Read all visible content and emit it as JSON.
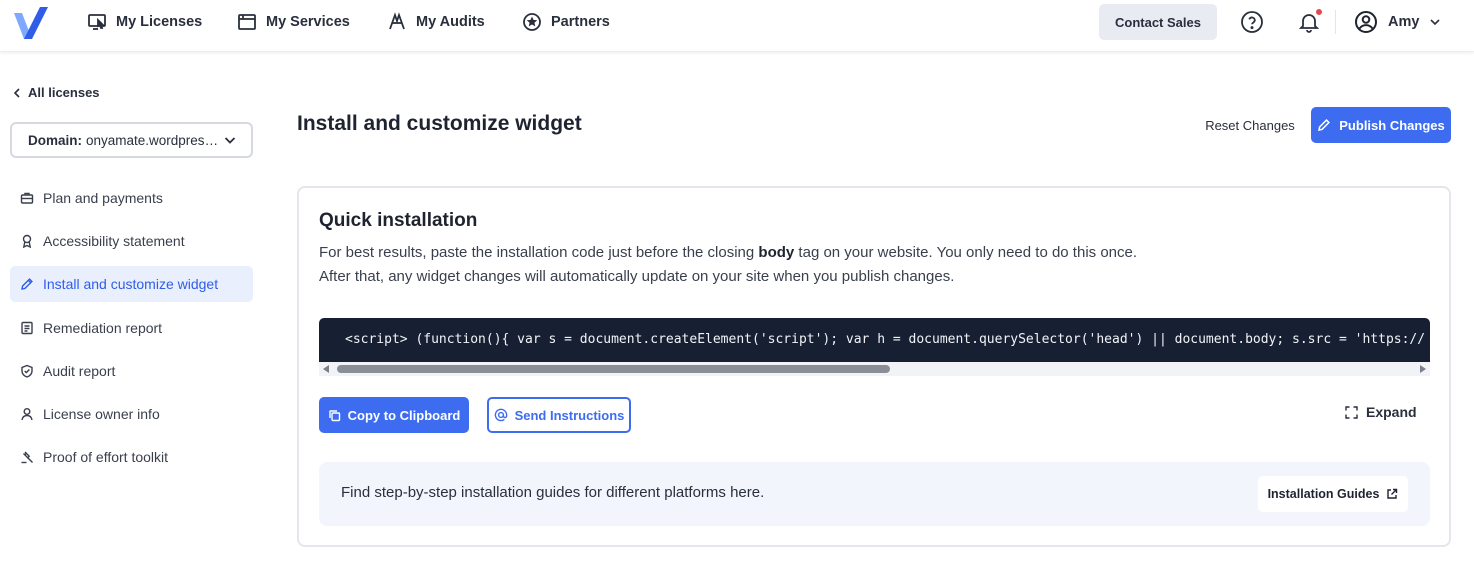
{
  "header": {
    "logo_icon": "checkmark-logo-icon",
    "nav": [
      {
        "label": "My Licenses",
        "icon": "monitor-cursor-icon"
      },
      {
        "label": "My Services",
        "icon": "window-icon"
      },
      {
        "label": "My Audits",
        "icon": "audit-compass-icon"
      },
      {
        "label": "Partners",
        "icon": "star-circle-icon"
      }
    ],
    "contact_sales": "Contact Sales",
    "help_icon": "question-circle-icon",
    "notification_icon": "bell-icon",
    "user": {
      "name": "Amy",
      "icon": "user-circle-icon"
    }
  },
  "sidebar": {
    "back_label": "All licenses",
    "domain": {
      "label": "Domain:",
      "value": "onyamate.wordpress.com"
    },
    "items": [
      {
        "label": "Plan and payments",
        "icon": "briefcase-icon",
        "active": false
      },
      {
        "label": "Accessibility statement",
        "icon": "award-icon",
        "active": false
      },
      {
        "label": "Install and customize widget",
        "icon": "pencil-icon",
        "active": true
      },
      {
        "label": "Remediation report",
        "icon": "document-icon",
        "active": false
      },
      {
        "label": "Audit report",
        "icon": "shield-check-icon",
        "active": false
      },
      {
        "label": "License owner info",
        "icon": "person-icon",
        "active": false
      },
      {
        "label": "Proof of effort toolkit",
        "icon": "gavel-icon",
        "active": false
      }
    ]
  },
  "main": {
    "title": "Install and customize widget",
    "reset_label": "Reset Changes",
    "publish_label": "Publish Changes",
    "card": {
      "title": "Quick installation",
      "desc_part1": "For best results, paste the installation code just before the closing ",
      "desc_bold": "body",
      "desc_part2": " tag on your website. You only need to do this once.",
      "desc_line2": "After that, any widget changes will automatically update on your site when you publish changes.",
      "code": "<script> (function(){ var s = document.createElement('script'); var h = document.querySelector('head') || document.body; s.src = 'https://",
      "copy_label": "Copy to Clipboard",
      "send_label": "Send Instructions",
      "expand_label": "Expand",
      "guide_text": "Find step-by-step installation guides for different platforms here.",
      "guide_button": "Installation Guides"
    }
  },
  "colors": {
    "accent": "#3d6cf0",
    "active_bg": "#e9effd",
    "code_bg": "#172033",
    "notification_dot": "#e5484d"
  }
}
